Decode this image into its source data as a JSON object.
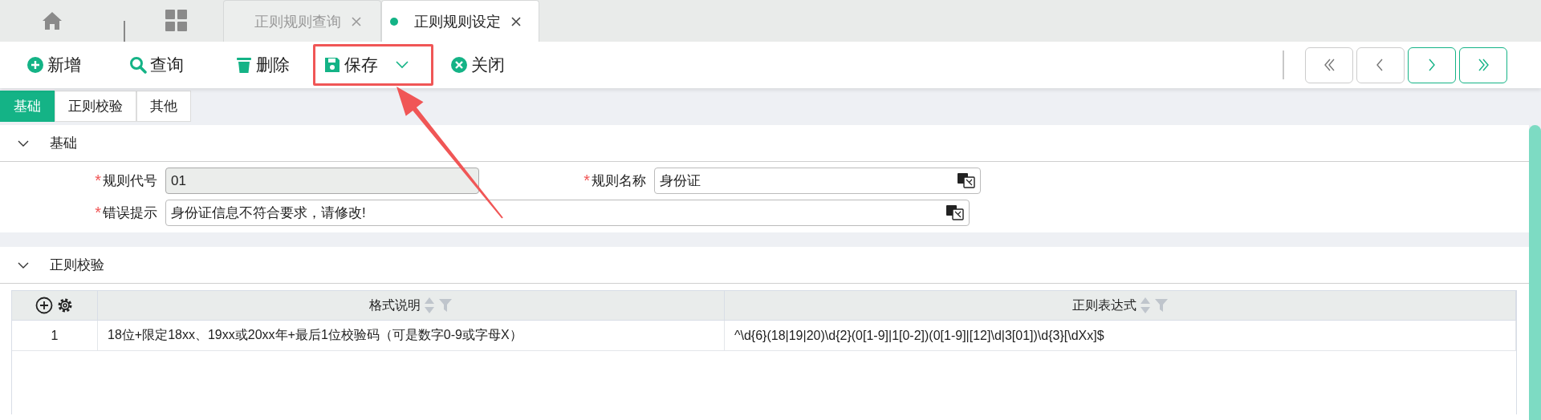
{
  "top_tabs": [
    {
      "label": "正则规则查询",
      "selected": false
    },
    {
      "label": "正则规则设定",
      "selected": true
    }
  ],
  "toolbar": [
    {
      "kind": "add",
      "label": "新增",
      "dropdown": false,
      "highlighted": false
    },
    {
      "kind": "search",
      "label": "查询",
      "dropdown": false,
      "highlighted": false
    },
    {
      "kind": "delete",
      "label": "删除",
      "dropdown": false,
      "highlighted": false
    },
    {
      "kind": "save",
      "label": "保存",
      "dropdown": true,
      "highlighted": true
    },
    {
      "kind": "close",
      "label": "关闭",
      "dropdown": false,
      "highlighted": false
    }
  ],
  "pager": [
    {
      "kind": "first",
      "disabled": true
    },
    {
      "kind": "prev",
      "disabled": true
    },
    {
      "kind": "next",
      "disabled": false
    },
    {
      "kind": "last",
      "disabled": false
    }
  ],
  "section_tabs": [
    {
      "label": "基础",
      "selected": true
    },
    {
      "label": "正则校验",
      "selected": false
    },
    {
      "label": "其他",
      "selected": false
    }
  ],
  "sections": [
    {
      "kind": "form",
      "title": "基础",
      "expanded": true,
      "rows": [
        [
          {
            "required_mark": "*",
            "label": "规则代号",
            "value": "01",
            "disabled": true,
            "translatable": false
          },
          {
            "required_mark": "*",
            "label": "规则名称",
            "value": "身份证",
            "disabled": false,
            "translatable": true
          }
        ],
        [
          {
            "required_mark": "*",
            "label": "错误提示",
            "value": "身份证信息不符合要求，请修改!",
            "disabled": false,
            "translatable": true
          }
        ]
      ]
    },
    {
      "kind": "table",
      "title": "正则校验",
      "expanded": true,
      "columns": [
        {
          "label": "格式说明",
          "sortable": true,
          "filterable": true
        },
        {
          "label": "正则表达式",
          "sortable": true,
          "filterable": true
        }
      ],
      "rows": [
        {
          "index": "1",
          "cells": [
            "18位+限定18xx、19xx或20xx年+最后1位校验码（可是数字0-9或字母X）",
            "^\\d{6}(18|19|20)\\d{2}(0[1-9]|1[0-2])(0[1-9]|[12]\\d|3[01])\\d{3}[\\dXx]$"
          ]
        }
      ]
    }
  ]
}
